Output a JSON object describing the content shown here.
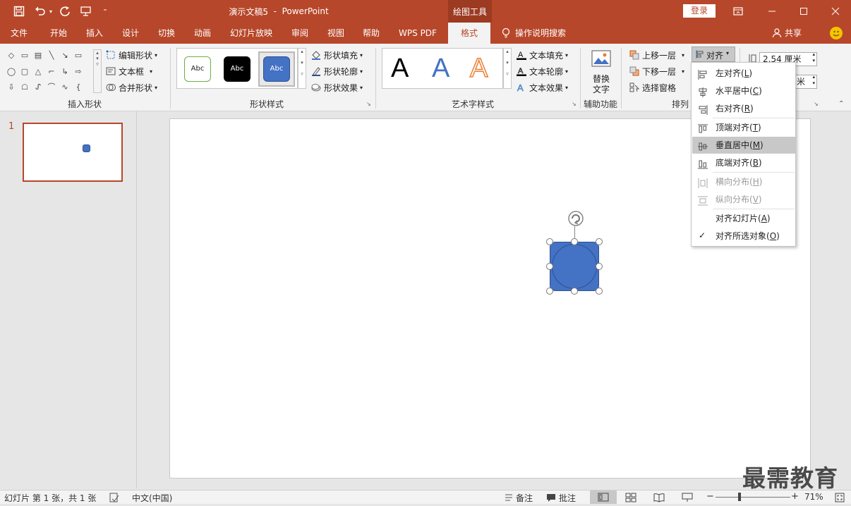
{
  "title_bar": {
    "doc_title": "演示文稿5",
    "separator": "-",
    "app_name": "PowerPoint",
    "context_group": "绘图工具",
    "login_label": "登录"
  },
  "tabs": [
    "文件",
    "开始",
    "插入",
    "设计",
    "切换",
    "动画",
    "幻灯片放映",
    "审阅",
    "视图",
    "帮助",
    "WPS PDF",
    "格式"
  ],
  "active_tab": "格式",
  "tell_me": "操作说明搜索",
  "share": "共享",
  "ribbon": {
    "insert_shapes": {
      "edit_shape": "编辑形状",
      "text_box": "文本框",
      "merge_shapes": "合并形状",
      "label": "插入形状"
    },
    "shape_styles": {
      "style_samples": [
        "Abc",
        "Abc",
        "Abc"
      ],
      "fill": "形状填充",
      "outline": "形状轮廓",
      "effects": "形状效果",
      "label": "形状样式"
    },
    "wordart_styles": {
      "samples": [
        "A",
        "A",
        "A"
      ],
      "text_fill": "文本填充",
      "text_outline": "文本轮廓",
      "text_effects": "文本效果",
      "label": "艺术字样式"
    },
    "accessibility": {
      "alt_text_line1": "替换",
      "alt_text_line2": "文字",
      "label": "辅助功能"
    },
    "arrange": {
      "bring_forward": "上移一层",
      "send_backward": "下移一层",
      "selection_pane": "选择窗格",
      "align": "对齐",
      "label": "排列"
    },
    "size": {
      "height": "2.54 厘米",
      "width": "米"
    }
  },
  "align_menu": {
    "items": [
      {
        "text": "左对齐(",
        "key": "L",
        "end": ")",
        "icon": "align-left-icon",
        "disabled": false,
        "highlight": false,
        "check": false
      },
      {
        "text": "水平居中(",
        "key": "C",
        "end": ")",
        "icon": "align-center-icon",
        "disabled": false,
        "highlight": false,
        "check": false
      },
      {
        "text": "右对齐(",
        "key": "R",
        "end": ")",
        "icon": "align-right-icon",
        "disabled": false,
        "highlight": false,
        "check": false
      },
      {
        "text": "顶端对齐(",
        "key": "T",
        "end": ")",
        "icon": "align-top-icon",
        "disabled": false,
        "highlight": false,
        "check": false
      },
      {
        "text": "垂直居中(",
        "key": "M",
        "end": ")",
        "icon": "align-middle-icon",
        "disabled": false,
        "highlight": true,
        "check": false
      },
      {
        "text": "底端对齐(",
        "key": "B",
        "end": ")",
        "icon": "align-bottom-icon",
        "disabled": false,
        "highlight": false,
        "check": false
      },
      {
        "text": "横向分布(",
        "key": "H",
        "end": ")",
        "icon": "distribute-horizontal-icon",
        "disabled": true,
        "highlight": false,
        "check": false
      },
      {
        "text": "纵向分布(",
        "key": "V",
        "end": ")",
        "icon": "distribute-vertical-icon",
        "disabled": true,
        "highlight": false,
        "check": false
      },
      {
        "text": "对齐幻灯片(",
        "key": "A",
        "end": ")",
        "icon": "",
        "disabled": false,
        "highlight": false,
        "check": false
      },
      {
        "text": "对齐所选对象(",
        "key": "O",
        "end": ")",
        "icon": "check-icon",
        "disabled": false,
        "highlight": false,
        "check": true
      }
    ],
    "check_mark": "✓"
  },
  "thumbnail": {
    "number": "1"
  },
  "status_bar": {
    "slide_info": "幻灯片 第 1 张，共 1 张",
    "language": "中文(中国)",
    "notes": "备注",
    "comments": "批注",
    "zoom": "71%",
    "zoom_minus": "−",
    "zoom_plus": "+"
  },
  "watermark": "最需教育",
  "colors": {
    "accent": "#b7472a",
    "shape_fill": "#4472c4",
    "shape_border": "#2f528f"
  }
}
